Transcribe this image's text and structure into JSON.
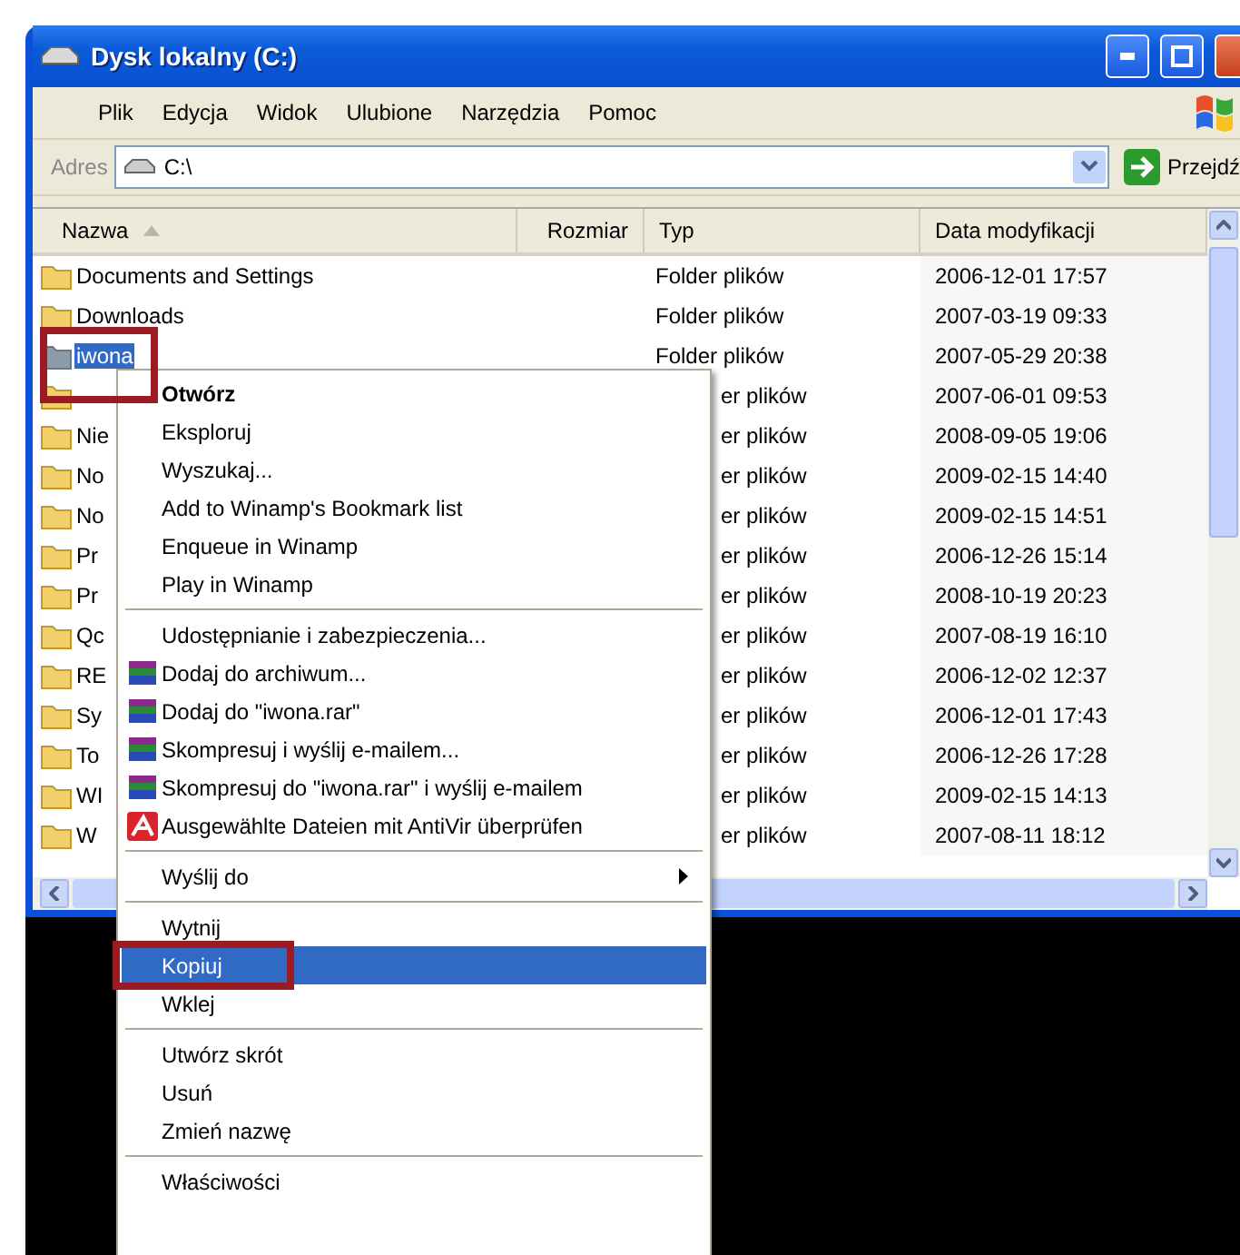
{
  "window": {
    "title": "Dysk lokalny (C:)"
  },
  "menu_bar": [
    "Plik",
    "Edycja",
    "Widok",
    "Ulubione",
    "Narzędzia",
    "Pomoc"
  ],
  "address_bar": {
    "label": "Adres",
    "value": "C:\\",
    "go_label": "Przejdź"
  },
  "columns": [
    "Nazwa",
    "Rozmiar",
    "Typ",
    "Data modyfikacji"
  ],
  "rows": [
    {
      "name": "Documents and Settings",
      "type": "Folder plików",
      "modified": "2006-12-01 17:57",
      "selected": false
    },
    {
      "name": "Downloads",
      "type": "Folder plików",
      "modified": "2007-03-19 09:33",
      "selected": false
    },
    {
      "name": "iwona",
      "type": "Folder plików",
      "modified": "2007-05-29 20:38",
      "selected": true
    },
    {
      "type": "er plików",
      "modified": "2007-06-01 09:53",
      "selected": false
    },
    {
      "name": "Nie",
      "type": "er plików",
      "modified": "2008-09-05 19:06",
      "selected": false
    },
    {
      "name": "No",
      "type": "er plików",
      "modified": "2009-02-15 14:40",
      "selected": false
    },
    {
      "name": "No",
      "type": "er plików",
      "modified": "2009-02-15 14:51",
      "selected": false
    },
    {
      "name": "Pr",
      "type": "er plików",
      "modified": "2006-12-26 15:14",
      "selected": false
    },
    {
      "name": "Pr",
      "type": "er plików",
      "modified": "2008-10-19 20:23",
      "selected": false
    },
    {
      "name": "Qc",
      "type": "er plików",
      "modified": "2007-08-19 16:10",
      "selected": false
    },
    {
      "name": "RE",
      "type": "er plików",
      "modified": "2006-12-02 12:37",
      "selected": false
    },
    {
      "name": "Sy",
      "type": "er plików",
      "modified": "2006-12-01 17:43",
      "selected": false
    },
    {
      "name": "To",
      "type": "er plików",
      "modified": "2006-12-26 17:28",
      "selected": false
    },
    {
      "name": "WI",
      "type": "er plików",
      "modified": "2009-02-15 14:13",
      "selected": false
    },
    {
      "name": "W",
      "type": "er plików",
      "modified": "2007-08-11 18:12",
      "selected": false
    }
  ],
  "context_menu": {
    "groups": [
      [
        {
          "label": "Otwórz",
          "kind": "plain",
          "default": true,
          "submenu": false,
          "selected": false
        },
        {
          "label": "Eksploruj",
          "kind": "plain",
          "default": false,
          "submenu": false,
          "selected": false
        },
        {
          "label": "Wyszukaj...",
          "kind": "plain",
          "default": false,
          "submenu": false,
          "selected": false
        },
        {
          "label": "Add to Winamp's Bookmark list",
          "kind": "plain",
          "default": false,
          "submenu": false,
          "selected": false
        },
        {
          "label": "Enqueue in Winamp",
          "kind": "plain",
          "default": false,
          "submenu": false,
          "selected": false
        },
        {
          "label": "Play in Winamp",
          "kind": "plain",
          "default": false,
          "submenu": false,
          "selected": false
        }
      ],
      [
        {
          "label": "Udostępnianie i zabezpieczenia...",
          "kind": "plain",
          "default": false,
          "submenu": false,
          "selected": false
        },
        {
          "label": "Dodaj do archiwum...",
          "kind": "archive",
          "default": false,
          "submenu": false,
          "selected": false
        },
        {
          "label": "Dodaj do \"iwona.rar\"",
          "kind": "archive",
          "default": false,
          "submenu": false,
          "selected": false
        },
        {
          "label": "Skompresuj i wyślij e-mailem...",
          "kind": "archive",
          "default": false,
          "submenu": false,
          "selected": false
        },
        {
          "label": "Skompresuj do \"iwona.rar\" i wyślij e-mailem",
          "kind": "archive",
          "default": false,
          "submenu": false,
          "selected": false
        },
        {
          "label": "Ausgewählte Dateien mit AntiVir überprüfen",
          "kind": "antivirus",
          "default": false,
          "submenu": false,
          "selected": false
        }
      ],
      [
        {
          "label": "Wyślij do",
          "kind": "plain",
          "default": false,
          "submenu": true,
          "selected": false
        }
      ],
      [
        {
          "label": "Wytnij",
          "kind": "plain",
          "default": false,
          "submenu": false,
          "selected": false
        },
        {
          "label": "Kopiuj",
          "kind": "plain",
          "default": false,
          "submenu": false,
          "selected": true
        },
        {
          "label": "Wklej",
          "kind": "plain",
          "default": false,
          "submenu": false,
          "selected": false
        }
      ],
      [
        {
          "label": "Utwórz skrót",
          "kind": "plain",
          "default": false,
          "submenu": false,
          "selected": false
        },
        {
          "label": "Usuń",
          "kind": "plain",
          "default": false,
          "submenu": false,
          "selected": false
        },
        {
          "label": "Zmień nazwę",
          "kind": "plain",
          "default": false,
          "submenu": false,
          "selected": false
        }
      ],
      [
        {
          "label": "Właściwości",
          "kind": "plain",
          "default": false,
          "submenu": false,
          "selected": false
        }
      ]
    ]
  }
}
